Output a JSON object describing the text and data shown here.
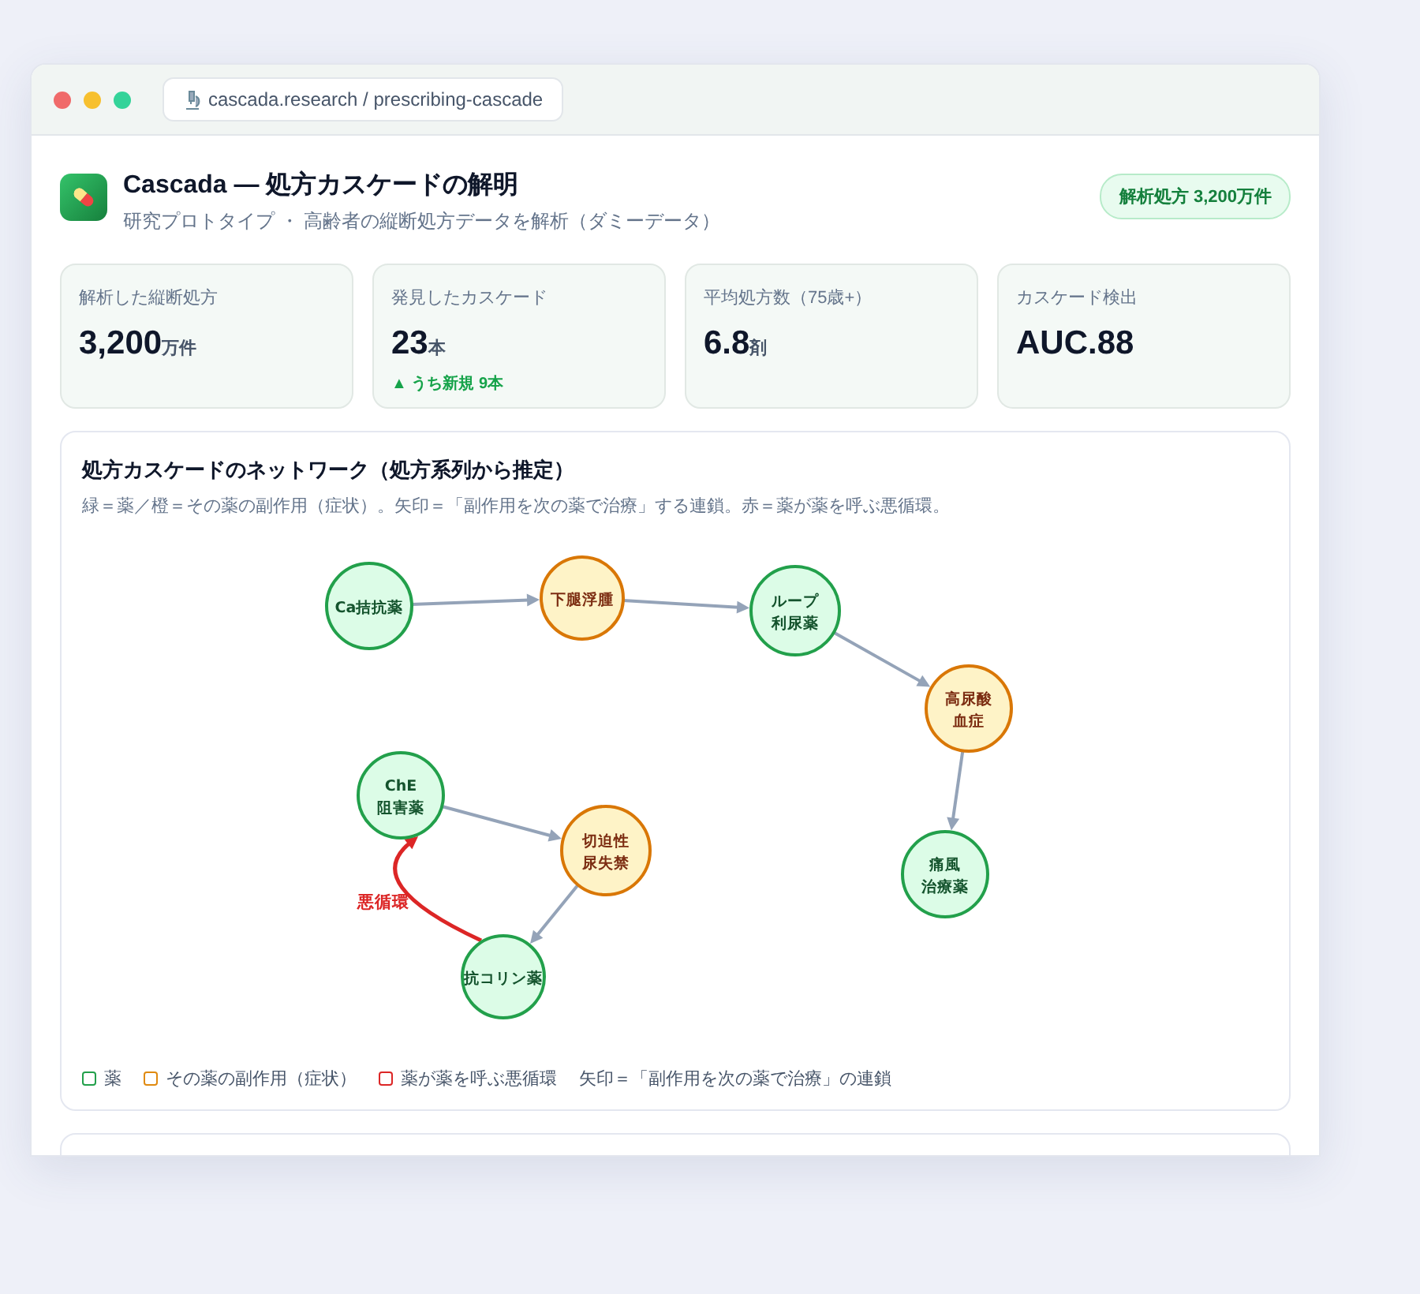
{
  "browser": {
    "url": "cascada.research / prescribing-cascade"
  },
  "header": {
    "title": "Cascada — 処方カスケードの解明",
    "subtitle": "研究プロトタイプ ・ 高齢者の縦断処方データを解析（ダミーデータ）",
    "badge": "解析処方 3,200万件"
  },
  "stats": [
    {
      "label": "解析した縦断処方",
      "value": "3,200",
      "unit": "万件"
    },
    {
      "label": "発見したカスケード",
      "value": "23",
      "unit": "本",
      "note": "▲ うち新規 9本"
    },
    {
      "label": "平均処方数（75歳+）",
      "value": "6.8",
      "unit": "剤"
    },
    {
      "label": "カスケード検出",
      "value": "AUC.88"
    }
  ],
  "network": {
    "title": "処方カスケードのネットワーク（処方系列から推定）",
    "description": "緑＝薬／橙＝その薬の副作用（症状）。矢印＝「副作用を次の薬で治療」する連鎖。赤＝薬が薬を呼ぶ悪循環。",
    "nodes": [
      {
        "kind": "drug",
        "lines": [
          "Ca拮抗薬"
        ]
      },
      {
        "kind": "effect",
        "lines": [
          "下腿浮腫"
        ]
      },
      {
        "kind": "drug",
        "lines": [
          "ループ",
          "利尿薬"
        ]
      },
      {
        "kind": "effect",
        "lines": [
          "高尿酸",
          "血症"
        ]
      },
      {
        "kind": "drug",
        "lines": [
          "痛風",
          "治療薬"
        ]
      },
      {
        "kind": "drug",
        "lines": [
          "ChE",
          "阻害薬"
        ]
      },
      {
        "kind": "effect",
        "lines": [
          "切迫性",
          "尿失禁"
        ]
      },
      {
        "kind": "drug",
        "lines": [
          "抗コリン薬"
        ]
      }
    ],
    "edges": [
      {
        "kind": "chain"
      },
      {
        "kind": "chain"
      },
      {
        "kind": "chain"
      },
      {
        "kind": "chain"
      },
      {
        "kind": "chain"
      },
      {
        "kind": "chain"
      },
      {
        "kind": "vicious",
        "label": "悪循環"
      }
    ],
    "legend": [
      {
        "label": "薬",
        "color": "#22a04b"
      },
      {
        "label": "その薬の副作用（症状）",
        "color": "#e08a10"
      },
      {
        "label": "薬が薬を呼ぶ悪循環",
        "color": "#dc2626"
      },
      {
        "label": "矢印＝「副作用を次の薬で治療」の連鎖"
      }
    ]
  }
}
